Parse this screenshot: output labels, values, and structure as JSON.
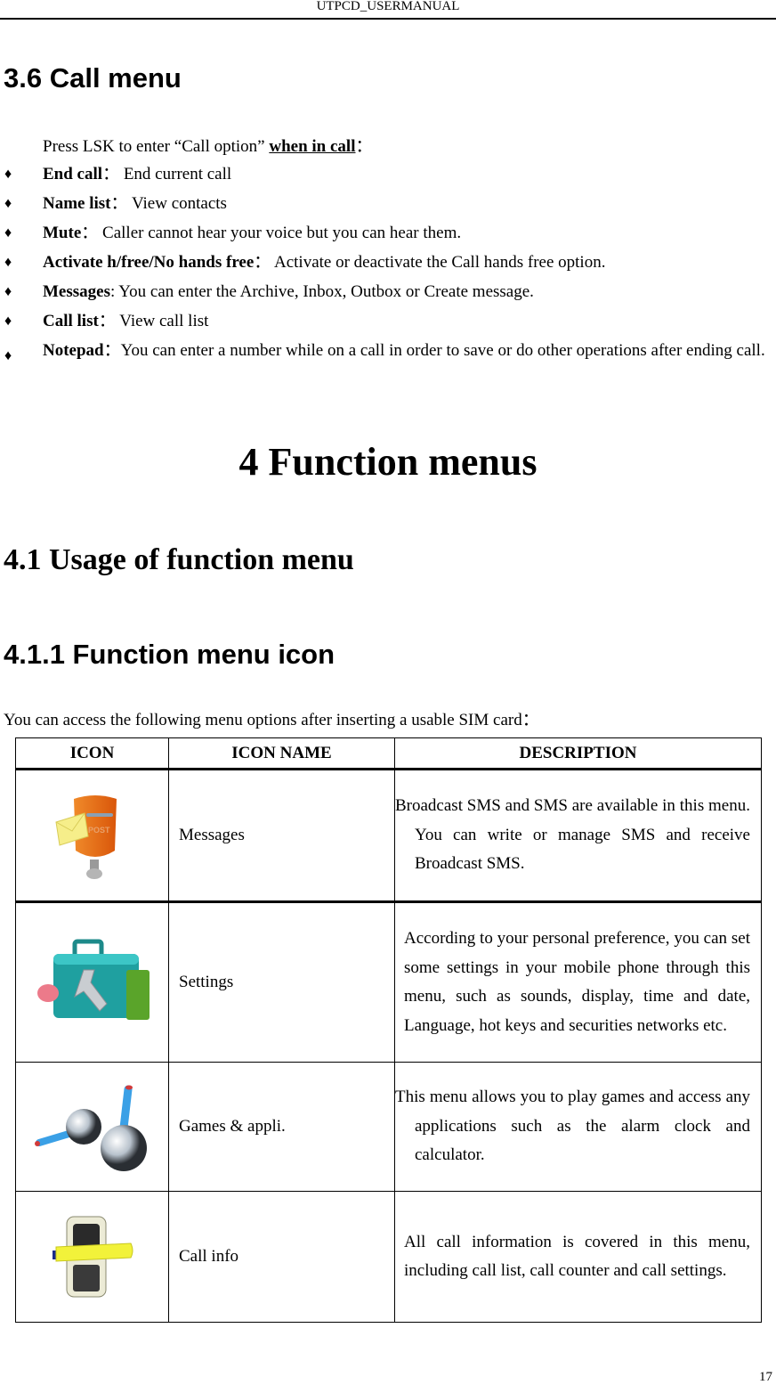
{
  "header": {
    "running_title": "UTPCD_USERMANUAL"
  },
  "section_3_6": {
    "heading": "3.6 Call menu",
    "intro_prefix": "Press LSK to enter “Call option” ",
    "intro_emphasis": "when in call",
    "intro_suffix": "：",
    "bullet_glyph": "♦",
    "items": [
      {
        "term": "End call",
        "sep": "：",
        "desc": " End current call"
      },
      {
        "term": "Name list",
        "sep": "：",
        "desc": " View contacts"
      },
      {
        "term": "Mute",
        "sep": "：",
        "desc": " Caller cannot hear your voice but you can hear them."
      },
      {
        "term": "Activate h/free/No hands free",
        "sep": "：",
        "desc": " Activate or deactivate the Call hands free option."
      },
      {
        "term": "Messages",
        "sep": ":",
        "desc": " You can enter the Archive, Inbox, Outbox or Create message."
      },
      {
        "term": "Call list",
        "sep": "：",
        "desc": " View call list"
      },
      {
        "term": "Notepad",
        "sep": "：",
        "desc": "You can enter a number while on a call in order to save or do other operations after ending call."
      }
    ]
  },
  "chapter_4": {
    "heading": "4 Function menus"
  },
  "section_4_1": {
    "heading": "4.1 Usage of function menu"
  },
  "section_4_1_1": {
    "heading": "4.1.1 Function menu icon",
    "intro": "You can access the following menu options after inserting a usable SIM card：",
    "table": {
      "columns": [
        "ICON",
        "ICON NAME",
        "DESCRIPTION"
      ],
      "rows": [
        {
          "icon": "mailbox-post-icon",
          "name": "Messages",
          "description": "Broadcast SMS and SMS are available in this menu. You can write or manage SMS and receive Broadcast SMS."
        },
        {
          "icon": "toolbox-wrench-icon",
          "name": "Settings",
          "description": "According to your personal preference, you can set some settings in your mobile phone through this menu, such as sounds, display, time and date, Language, hot keys and securities networks etc."
        },
        {
          "icon": "joystick-icon",
          "name": "Games & appli.",
          "description": "This menu allows you to play games and access any applications such as the alarm clock and calculator."
        },
        {
          "icon": "phone-tag-icon",
          "name": "Call info",
          "description": "All call information is covered in this menu, including call list, call counter and call settings."
        }
      ]
    }
  },
  "footer": {
    "page_number": "17"
  }
}
